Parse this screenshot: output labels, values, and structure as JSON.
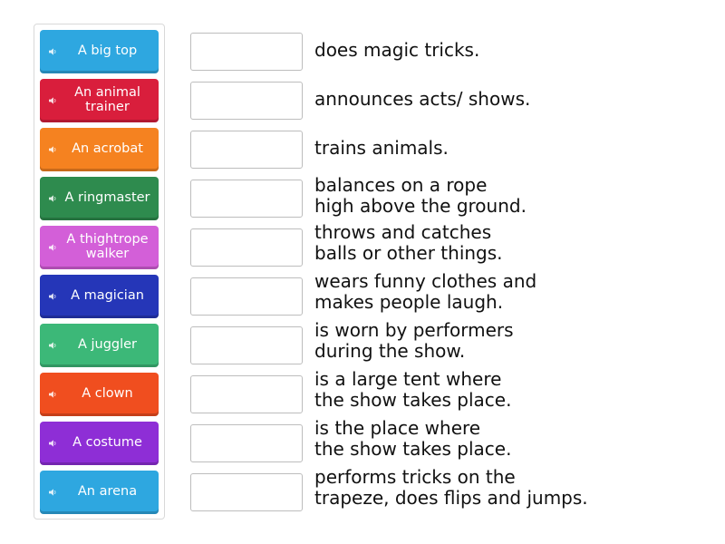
{
  "tiles": [
    {
      "label": "A big top",
      "color": "#2ea7e0"
    },
    {
      "label": "An animal trainer",
      "color": "#d91e3c"
    },
    {
      "label": "An acrobat",
      "color": "#f58220"
    },
    {
      "label": "A ringmaster",
      "color": "#2e8b4e"
    },
    {
      "label": "A thightrope walker",
      "color": "#d35fd8"
    },
    {
      "label": "A magician",
      "color": "#2536b8"
    },
    {
      "label": "A juggler",
      "color": "#3cb878"
    },
    {
      "label": "A clown",
      "color": "#f04e1f"
    },
    {
      "label": "A costume",
      "color": "#8e2ed6"
    },
    {
      "label": "An arena",
      "color": "#2ea7e0"
    }
  ],
  "descriptions": [
    {
      "line1": "does magic tricks.",
      "line2": ""
    },
    {
      "line1": "announces acts/ shows.",
      "line2": ""
    },
    {
      "line1": "trains animals.",
      "line2": ""
    },
    {
      "line1": "balances on a rope",
      "line2": "high above the ground."
    },
    {
      "line1": "throws and catches",
      "line2": "balls or other things."
    },
    {
      "line1": "wears funny clothes and",
      "line2": "makes people laugh."
    },
    {
      "line1": "is worn by performers",
      "line2": "during the show."
    },
    {
      "line1": "is a large tent where",
      "line2": "the show takes place."
    },
    {
      "line1": "is the place where",
      "line2": "the show takes place."
    },
    {
      "line1": "performs tricks on the",
      "line2": "trapeze, does flips and jumps."
    }
  ],
  "icons": {
    "tile_icon": "speaker-icon"
  }
}
